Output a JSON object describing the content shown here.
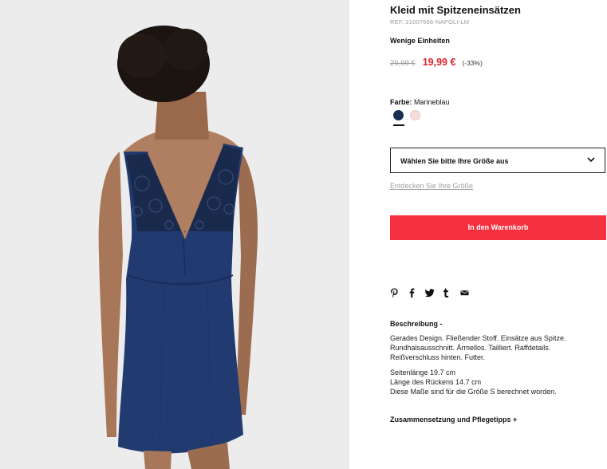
{
  "product": {
    "title": "Kleid mit Spitzeneinsätzen",
    "ref": "REF. 21007686-NAPOLI-LM",
    "stock": "Wenige Einheiten",
    "old_price": "29,99 €",
    "new_price": "19,99 €",
    "discount": "(-33%)"
  },
  "color": {
    "label": "Farbe:",
    "value": "Marineblau",
    "swatches": [
      {
        "name": "navy",
        "hex": "#1a2e55"
      },
      {
        "name": "pink",
        "hex": "#f6dcda"
      }
    ]
  },
  "size": {
    "select_label": "Wählen Sie bitte Ihre Größe aus",
    "guide_link": "Entdecken Sie Ihre Größe"
  },
  "cart": {
    "button_label": "In den Warenkorb"
  },
  "share": {
    "icons": [
      "pinterest-icon",
      "facebook-icon",
      "twitter-icon",
      "tumblr-icon",
      "email-icon"
    ]
  },
  "description": {
    "heading": "Beschreibung -",
    "text1": "Gerades Design. Fließender Stoff. Einsätze aus Spitze. Rundhalsausschnitt. Ärmellos. Tailliert. Raffdetails. Reißverschluss hinten. Futter.",
    "line1": "Seitenlänge 19.7 cm",
    "line2": "Länge des Rückens 14.7 cm",
    "line3": "Diese Maße sind für die Größe S berechnet worden."
  },
  "composition": {
    "heading": "Zusammensetzung und Pflegetipps +"
  },
  "colors": {
    "accent": "#f5303f",
    "sale": "#e0232e",
    "navy": "#1a2e55"
  }
}
